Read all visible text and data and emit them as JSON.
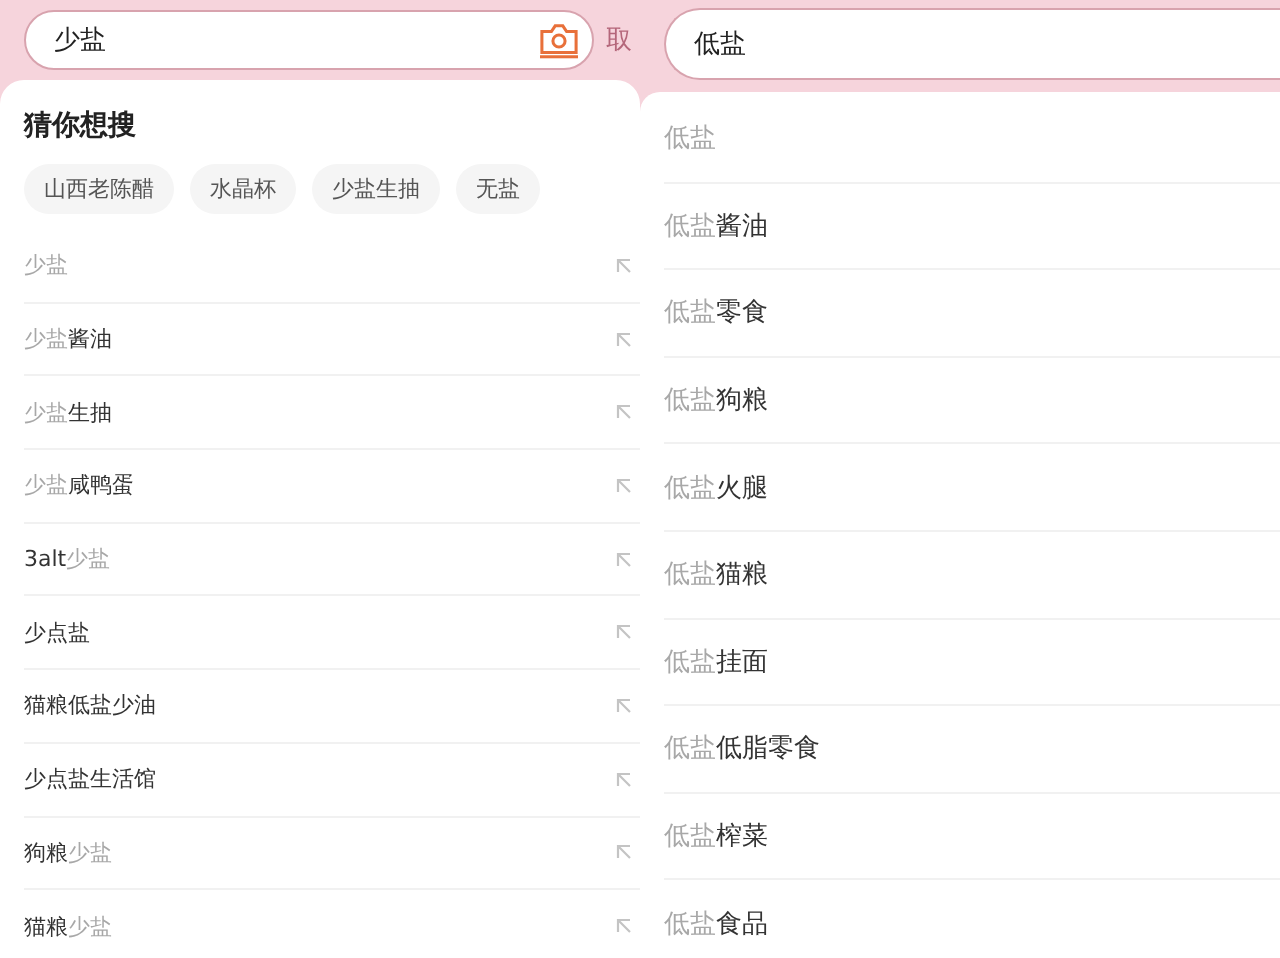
{
  "panels": [
    {
      "search": {
        "value": "少盐",
        "camera": true,
        "cancel": "取"
      },
      "guess": {
        "title": "猜你想搜",
        "chips": [
          "山西老陈醋",
          "水晶杯",
          "少盐生抽",
          "无盐"
        ]
      },
      "arrows": true,
      "suggestions": [
        [
          {
            "text": "少盐",
            "match": true
          }
        ],
        [
          {
            "text": "少盐",
            "match": true
          },
          {
            "text": "酱油",
            "match": false
          }
        ],
        [
          {
            "text": "少盐",
            "match": true
          },
          {
            "text": "生抽",
            "match": false
          }
        ],
        [
          {
            "text": "少盐",
            "match": true
          },
          {
            "text": "咸鸭蛋",
            "match": false
          }
        ],
        [
          {
            "text": "3alt",
            "match": false
          },
          {
            "text": "少盐",
            "match": true
          }
        ],
        [
          {
            "text": "少点盐",
            "match": false
          }
        ],
        [
          {
            "text": "猫粮低盐少油",
            "match": false
          }
        ],
        [
          {
            "text": "少点盐生活馆",
            "match": false
          }
        ],
        [
          {
            "text": "狗粮",
            "match": false
          },
          {
            "text": "少盐",
            "match": true
          }
        ],
        [
          {
            "text": "猫粮",
            "match": false
          },
          {
            "text": "少盐",
            "match": true
          }
        ]
      ]
    },
    {
      "search": {
        "value": "低盐"
      },
      "suggestions": [
        [
          {
            "text": "低盐",
            "match": true
          }
        ],
        [
          {
            "text": "低盐",
            "match": true
          },
          {
            "text": "酱油",
            "match": false
          }
        ],
        [
          {
            "text": "低盐",
            "match": true
          },
          {
            "text": "零食",
            "match": false
          }
        ],
        [
          {
            "text": "低盐",
            "match": true
          },
          {
            "text": "狗粮",
            "match": false
          }
        ],
        [
          {
            "text": "低盐",
            "match": true
          },
          {
            "text": "火腿",
            "match": false
          }
        ],
        [
          {
            "text": "低盐",
            "match": true
          },
          {
            "text": "猫粮",
            "match": false
          }
        ],
        [
          {
            "text": "低盐",
            "match": true
          },
          {
            "text": "挂面",
            "match": false
          }
        ],
        [
          {
            "text": "低盐",
            "match": true
          },
          {
            "text": "低脂零食",
            "match": false
          }
        ],
        [
          {
            "text": "低盐",
            "match": true
          },
          {
            "text": "榨菜",
            "match": false
          }
        ],
        [
          {
            "text": "低盐",
            "match": true
          },
          {
            "text": "食品",
            "match": false
          }
        ]
      ]
    }
  ]
}
